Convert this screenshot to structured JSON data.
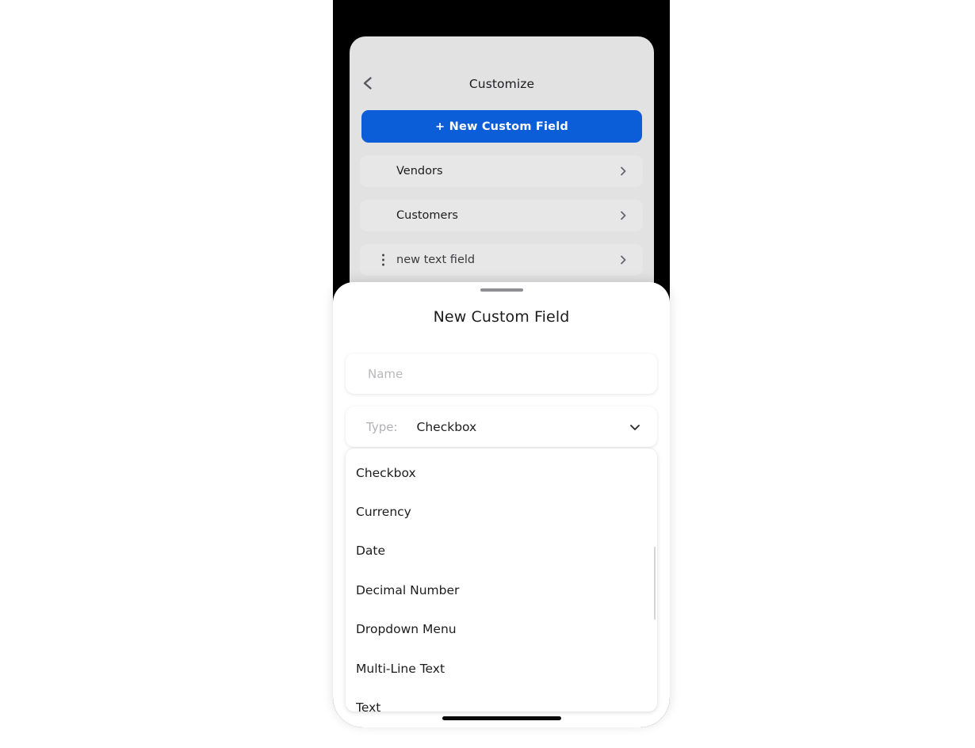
{
  "device": {
    "privacy_indicator": "green-dot"
  },
  "background_screen": {
    "back_icon": "chevron-left-icon",
    "title": "Customize",
    "primary_button": {
      "label": "+ New Custom Field",
      "color": "#0c5ed8"
    },
    "rows": [
      {
        "label": "Vendors",
        "has_drag_handle": false,
        "chevron": "chevron-right-icon"
      },
      {
        "label": "Customers",
        "has_drag_handle": false,
        "chevron": "chevron-right-icon"
      },
      {
        "label": "new text field",
        "has_drag_handle": true,
        "chevron": "chevron-right-icon"
      }
    ]
  },
  "bottom_sheet": {
    "grabber": "drag-handle",
    "title": "New Custom Field",
    "name_field": {
      "value": "",
      "placeholder": "Name"
    },
    "type_field": {
      "label": "Type:",
      "value": "Checkbox",
      "chevron": "chevron-down-icon"
    },
    "type_options": [
      "Checkbox",
      "Currency",
      "Date",
      "Decimal Number",
      "Dropdown Menu",
      "Multi-Line Text",
      "Text"
    ]
  },
  "home_indicator": "home-bar"
}
